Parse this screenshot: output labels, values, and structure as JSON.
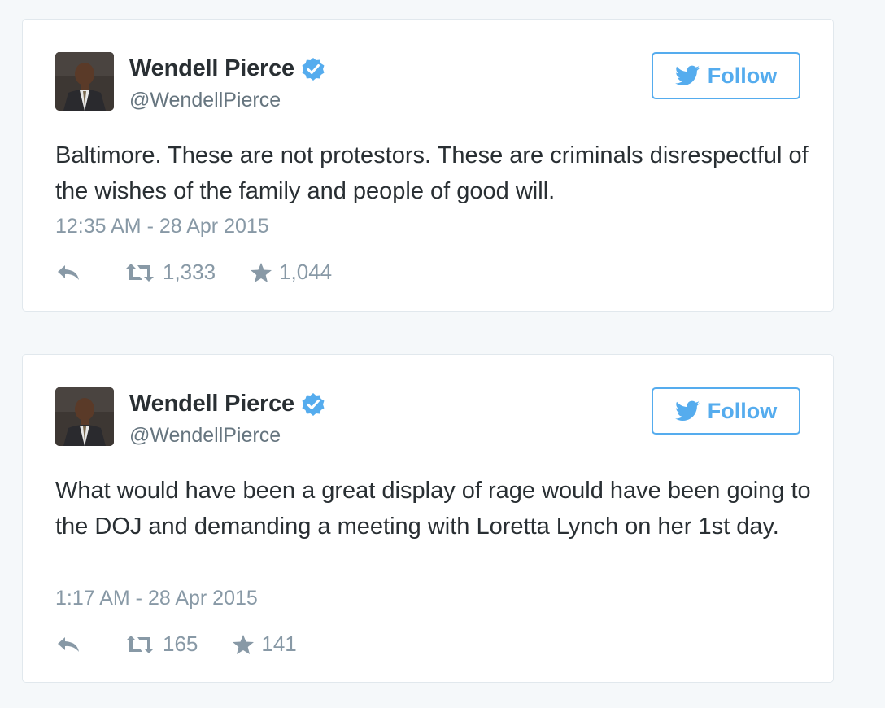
{
  "colors": {
    "accent": "#55acee",
    "text": "#292f33",
    "muted": "#8899a6",
    "verified": "#55acee"
  },
  "tweets": [
    {
      "author": {
        "name": "Wendell Pierce",
        "handle": "@WendellPierce",
        "verified": true,
        "avatar_icon": "profile-photo"
      },
      "follow_label": "Follow",
      "text": "Baltimore. These are not protestors. These are criminals disrespectful of the wishes of the family and people of good will.",
      "timestamp": "12:35 AM - 28 Apr 2015",
      "retweets": "1,333",
      "favorites": "1,044"
    },
    {
      "author": {
        "name": "Wendell Pierce",
        "handle": "@WendellPierce",
        "verified": true,
        "avatar_icon": "profile-photo"
      },
      "follow_label": "Follow",
      "text": "What would have been a great display of rage would have been going to the DOJ and demanding a meeting with Loretta Lynch on her 1st day.",
      "timestamp": "1:17 AM - 28 Apr 2015",
      "retweets": "165",
      "favorites": "141"
    }
  ]
}
